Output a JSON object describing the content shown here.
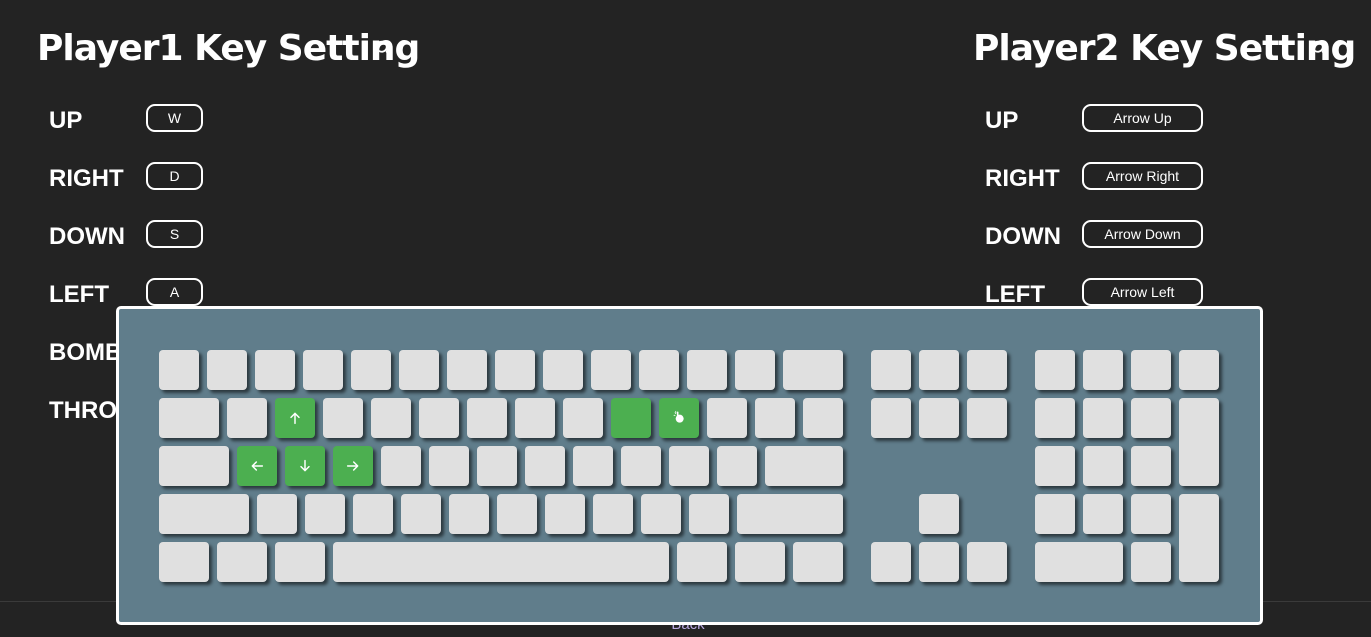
{
  "player1": {
    "title": "Player1 Key Setting",
    "rows": [
      {
        "label": "UP",
        "key": "W"
      },
      {
        "label": "RIGHT",
        "key": "D"
      },
      {
        "label": "DOWN",
        "key": "S"
      },
      {
        "label": "LEFT",
        "key": "A"
      },
      {
        "label": "BOMB",
        "key": ""
      },
      {
        "label": "THROW",
        "key": ""
      }
    ]
  },
  "player2": {
    "title": "Player2 Key Setting",
    "rows": [
      {
        "label": "UP",
        "key": "Arrow Up"
      },
      {
        "label": "RIGHT",
        "key": "Arrow Right"
      },
      {
        "label": "DOWN",
        "key": "Arrow Down"
      },
      {
        "label": "LEFT",
        "key": "Arrow Left"
      }
    ]
  },
  "footer": {
    "back_label": "Back"
  },
  "keyboard": {
    "highlight_color": "#4caf50",
    "key_color": "#e0e0e0",
    "background_color": "#607d8b",
    "highlighted": [
      {
        "key": "W",
        "icon": "arrow-up-icon"
      },
      {
        "key": "A",
        "icon": "arrow-left-icon"
      },
      {
        "key": "S",
        "icon": "arrow-down-icon"
      },
      {
        "key": "D",
        "icon": "arrow-right-icon"
      },
      {
        "key": "O",
        "icon": ""
      },
      {
        "key": "P",
        "icon": "pointer-hand-icon"
      }
    ]
  },
  "icons": {
    "search": "search-icon"
  }
}
